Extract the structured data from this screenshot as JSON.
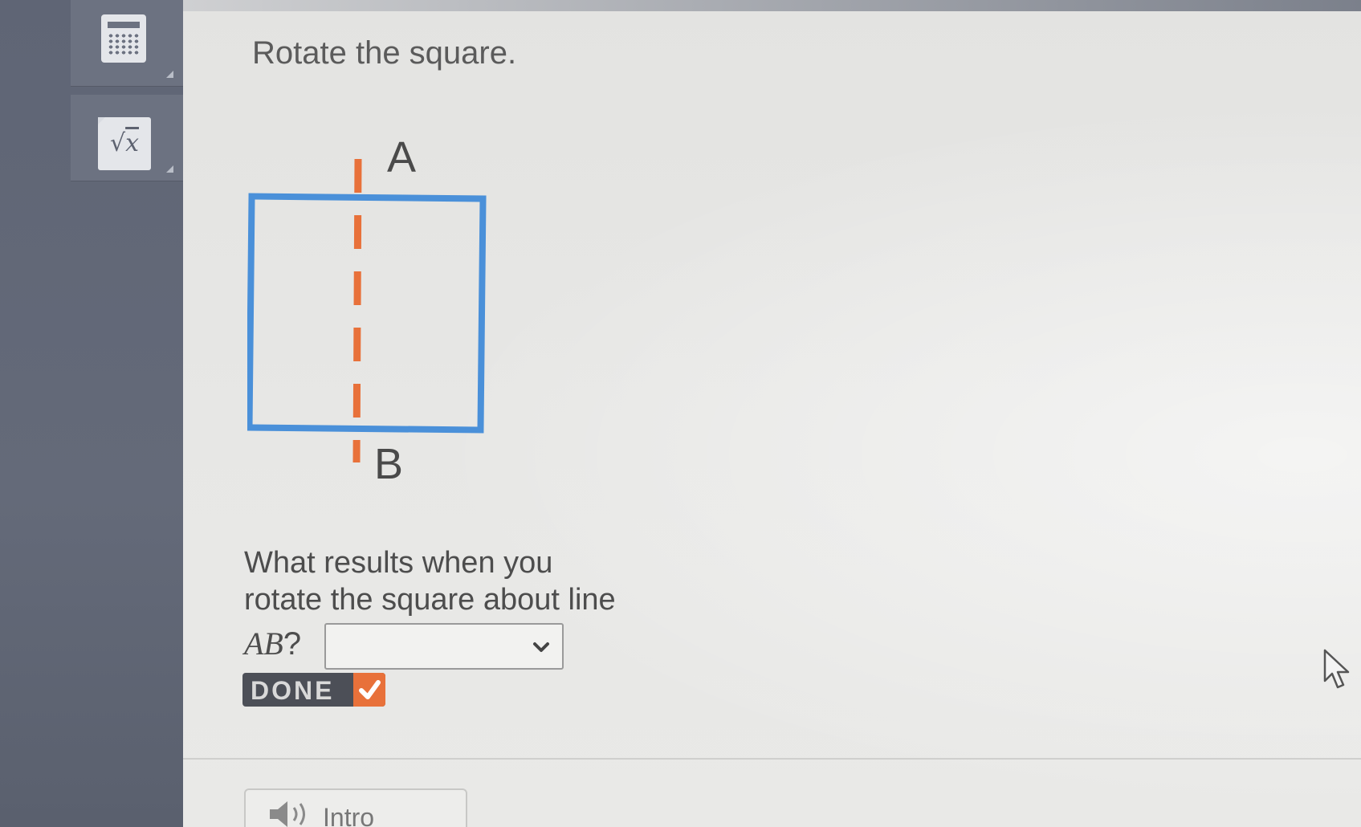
{
  "sidebar": {
    "tools": [
      {
        "name": "calculator",
        "icon": "calculator-icon"
      },
      {
        "name": "formula",
        "icon": "square-root-icon",
        "glyph": "√",
        "radicand": "x"
      }
    ]
  },
  "main": {
    "title": "Rotate the square.",
    "figure": {
      "label_top": "A",
      "label_bottom": "B",
      "square_color": "#4a90d9",
      "axis_color": "#e8713a"
    },
    "question": {
      "line1": "What results when you",
      "line2": "rotate the square about line",
      "line_name": "AB",
      "qmark": "?"
    },
    "answer_select": {
      "value": "",
      "icon": "chevron-down-icon"
    },
    "done_button": {
      "label": "DONE",
      "icon": "check-icon"
    },
    "intro_tab": {
      "label": "Intro",
      "icon": "speaker-icon"
    }
  }
}
